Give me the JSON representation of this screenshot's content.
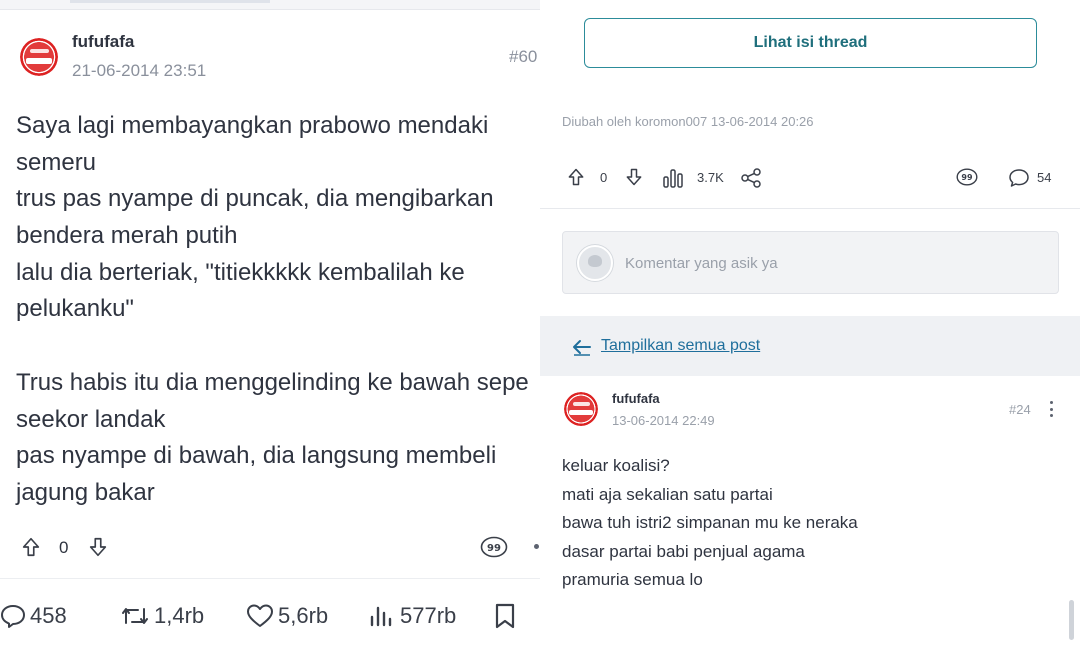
{
  "left": {
    "username": "fufufafa",
    "timestamp": "21-06-2014 23:51",
    "post_number": "#60",
    "body_lines": [
      "Saya lagi membayangkan prabowo mendaki",
      "semeru",
      "trus pas nyampe di puncak, dia mengibarkan",
      "bendera merah putih",
      "lalu dia berteriak, \"titiekkkkk kembalilah ke",
      "pelukanku\"",
      "",
      "Trus habis itu dia menggelinding ke bawah sepe",
      "seekor landak",
      "pas nyampe di bawah, dia langsung membeli",
      "jagung bakar"
    ],
    "vote_count": "0",
    "quote_label": "99",
    "stats": {
      "replies": "458",
      "reposts": "1,4rb",
      "likes": "5,6rb",
      "views": "577rb"
    }
  },
  "right": {
    "thread_button": "Lihat isi thread",
    "edited_note": "Diubah oleh koromon007 13-06-2014 20:26",
    "vote_count": "0",
    "views": "3.7K",
    "quote_label": "99",
    "comments": "54",
    "comment_placeholder": "Komentar yang asik ya",
    "show_all_label": "Tampilkan semua post",
    "post": {
      "username": "fufufafa",
      "timestamp": "13-06-2014 22:49",
      "post_number": "#24",
      "body_lines": [
        "keluar koalisi?",
        "mati aja sekalian satu partai",
        "bawa tuh istri2 simpanan mu ke neraka",
        "dasar partai babi penjual agama",
        "pramuria semua lo"
      ]
    }
  },
  "colors": {
    "accent_teal": "#2c8c9a",
    "link_blue": "#1f6f9c",
    "muted_gray": "#8a909c",
    "avatar_red": "#e23b3b"
  },
  "icons": [
    "upvote-icon",
    "downvote-icon",
    "quote-icon",
    "views-icon",
    "share-icon",
    "comment-icon",
    "reply-icon",
    "repost-icon",
    "heart-icon",
    "bookmark-icon",
    "back-arrow-icon",
    "kebab-menu-icon"
  ]
}
